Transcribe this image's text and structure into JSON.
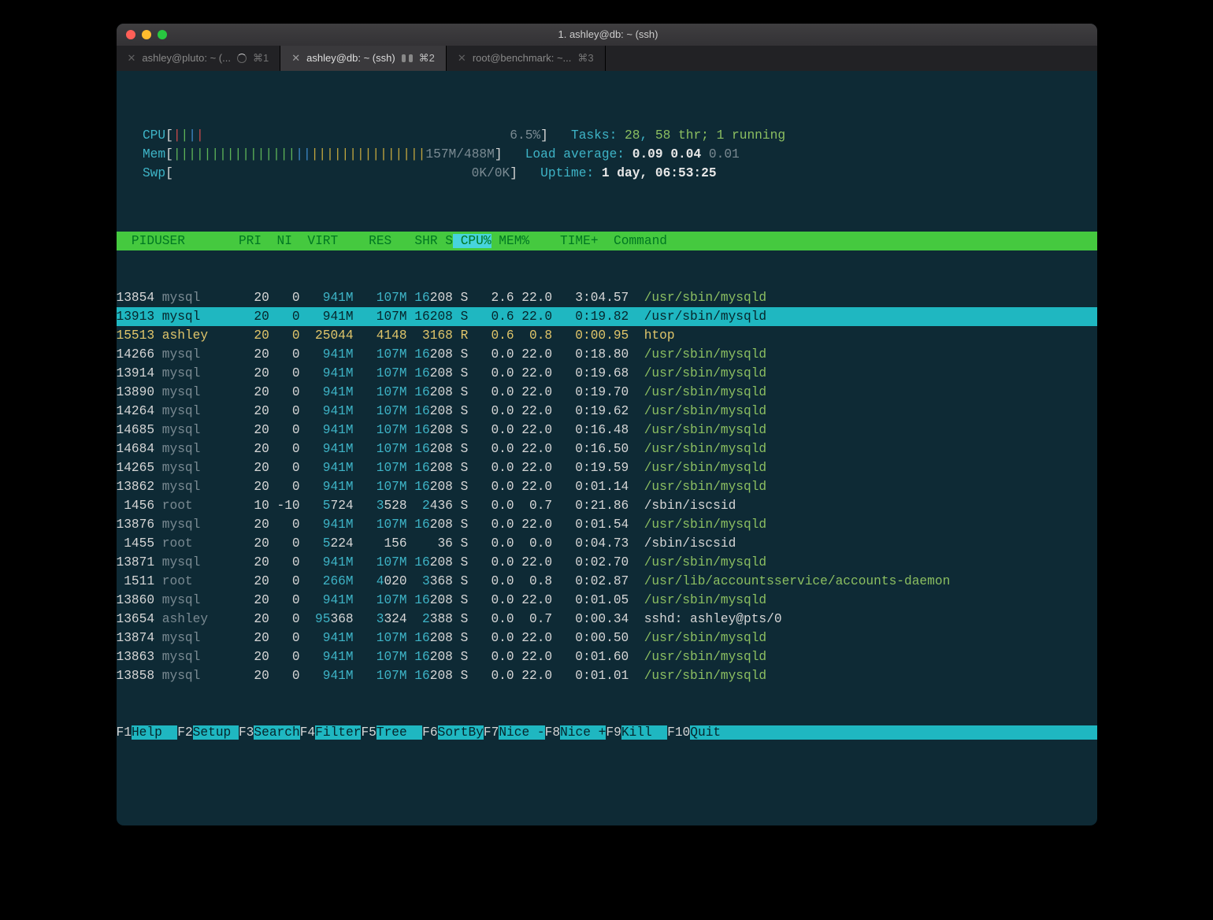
{
  "window": {
    "title": "1. ashley@db: ~ (ssh)"
  },
  "tabs": [
    {
      "label": "ashley@pluto: ~ (...",
      "shortcut": "⌘1",
      "active": false,
      "spinner": true
    },
    {
      "label": "ashley@db: ~ (ssh)",
      "shortcut": "⌘2",
      "active": true
    },
    {
      "label": "root@benchmark: ~...",
      "shortcut": "⌘3",
      "active": false
    }
  ],
  "meters": {
    "cpu": {
      "label": "CPU",
      "pct": "6.5%"
    },
    "mem": {
      "label": "Mem",
      "used": "157M",
      "total": "488M"
    },
    "swp": {
      "label": "Swp",
      "used": "0K",
      "total": "0K"
    },
    "tasks": {
      "label": "Tasks:",
      "procs": "28",
      "threads": "58 thr;",
      "running": "1 running"
    },
    "load": {
      "label": "Load average:",
      "l1": "0.09",
      "l2": "0.04",
      "l3": "0.01"
    },
    "uptime": {
      "label": "Uptime:",
      "val": "1 day, 06:53:25"
    }
  },
  "columns": [
    "  PID",
    "USER      ",
    " PRI",
    "  NI",
    "  VIRT",
    "    RES",
    "   SHR",
    " S",
    " CPU%",
    " MEM%",
    "    TIME+",
    "  Command"
  ],
  "processes": [
    {
      "pid": "13854",
      "user": "mysql",
      "pri": "20",
      "ni": "0",
      "virt": "941M",
      "res": "107M",
      "shr": "16208",
      "s": "S",
      "cpu": "2.6",
      "mem": "22.0",
      "time": "3:04.57",
      "cmd": "/usr/sbin/mysqld",
      "sel": false,
      "bold": false,
      "dimuser": true
    },
    {
      "pid": "13913",
      "user": "mysql",
      "pri": "20",
      "ni": "0",
      "virt": "941M",
      "res": "107M",
      "shr": "16208",
      "s": "S",
      "cpu": "0.6",
      "mem": "22.0",
      "time": "0:19.82",
      "cmd": "/usr/sbin/mysqld",
      "sel": true,
      "bold": false,
      "dimuser": false
    },
    {
      "pid": "15513",
      "user": "ashley",
      "pri": "20",
      "ni": "0",
      "virt": "25044",
      "res": "4148",
      "shr": "3168",
      "s": "R",
      "cpu": "0.6",
      "mem": "0.8",
      "time": "0:00.95",
      "cmd": "htop",
      "sel": false,
      "bold": true,
      "dimuser": false
    },
    {
      "pid": "14266",
      "user": "mysql",
      "pri": "20",
      "ni": "0",
      "virt": "941M",
      "res": "107M",
      "shr": "16208",
      "s": "S",
      "cpu": "0.0",
      "mem": "22.0",
      "time": "0:18.80",
      "cmd": "/usr/sbin/mysqld",
      "sel": false,
      "bold": false,
      "dimuser": true
    },
    {
      "pid": "13914",
      "user": "mysql",
      "pri": "20",
      "ni": "0",
      "virt": "941M",
      "res": "107M",
      "shr": "16208",
      "s": "S",
      "cpu": "0.0",
      "mem": "22.0",
      "time": "0:19.68",
      "cmd": "/usr/sbin/mysqld",
      "sel": false,
      "bold": false,
      "dimuser": true
    },
    {
      "pid": "13890",
      "user": "mysql",
      "pri": "20",
      "ni": "0",
      "virt": "941M",
      "res": "107M",
      "shr": "16208",
      "s": "S",
      "cpu": "0.0",
      "mem": "22.0",
      "time": "0:19.70",
      "cmd": "/usr/sbin/mysqld",
      "sel": false,
      "bold": false,
      "dimuser": true
    },
    {
      "pid": "14264",
      "user": "mysql",
      "pri": "20",
      "ni": "0",
      "virt": "941M",
      "res": "107M",
      "shr": "16208",
      "s": "S",
      "cpu": "0.0",
      "mem": "22.0",
      "time": "0:19.62",
      "cmd": "/usr/sbin/mysqld",
      "sel": false,
      "bold": false,
      "dimuser": true
    },
    {
      "pid": "14685",
      "user": "mysql",
      "pri": "20",
      "ni": "0",
      "virt": "941M",
      "res": "107M",
      "shr": "16208",
      "s": "S",
      "cpu": "0.0",
      "mem": "22.0",
      "time": "0:16.48",
      "cmd": "/usr/sbin/mysqld",
      "sel": false,
      "bold": false,
      "dimuser": true
    },
    {
      "pid": "14684",
      "user": "mysql",
      "pri": "20",
      "ni": "0",
      "virt": "941M",
      "res": "107M",
      "shr": "16208",
      "s": "S",
      "cpu": "0.0",
      "mem": "22.0",
      "time": "0:16.50",
      "cmd": "/usr/sbin/mysqld",
      "sel": false,
      "bold": false,
      "dimuser": true
    },
    {
      "pid": "14265",
      "user": "mysql",
      "pri": "20",
      "ni": "0",
      "virt": "941M",
      "res": "107M",
      "shr": "16208",
      "s": "S",
      "cpu": "0.0",
      "mem": "22.0",
      "time": "0:19.59",
      "cmd": "/usr/sbin/mysqld",
      "sel": false,
      "bold": false,
      "dimuser": true
    },
    {
      "pid": "13862",
      "user": "mysql",
      "pri": "20",
      "ni": "0",
      "virt": "941M",
      "res": "107M",
      "shr": "16208",
      "s": "S",
      "cpu": "0.0",
      "mem": "22.0",
      "time": "0:01.14",
      "cmd": "/usr/sbin/mysqld",
      "sel": false,
      "bold": false,
      "dimuser": true
    },
    {
      "pid": "1456",
      "user": "root",
      "pri": "10",
      "ni": "-10",
      "virt": "5724",
      "res": "3528",
      "shr": "2436",
      "s": "S",
      "cpu": "0.0",
      "mem": "0.7",
      "time": "0:21.86",
      "cmd": "/sbin/iscsid",
      "sel": false,
      "bold": false,
      "dimuser": true,
      "nineg": true,
      "cmdwhite": true
    },
    {
      "pid": "13876",
      "user": "mysql",
      "pri": "20",
      "ni": "0",
      "virt": "941M",
      "res": "107M",
      "shr": "16208",
      "s": "S",
      "cpu": "0.0",
      "mem": "22.0",
      "time": "0:01.54",
      "cmd": "/usr/sbin/mysqld",
      "sel": false,
      "bold": false,
      "dimuser": true
    },
    {
      "pid": "1455",
      "user": "root",
      "pri": "20",
      "ni": "0",
      "virt": "5224",
      "res": "156",
      "shr": "36",
      "s": "S",
      "cpu": "0.0",
      "mem": "0.0",
      "time": "0:04.73",
      "cmd": "/sbin/iscsid",
      "sel": false,
      "bold": false,
      "dimuser": true,
      "cmdwhite": true
    },
    {
      "pid": "13871",
      "user": "mysql",
      "pri": "20",
      "ni": "0",
      "virt": "941M",
      "res": "107M",
      "shr": "16208",
      "s": "S",
      "cpu": "0.0",
      "mem": "22.0",
      "time": "0:02.70",
      "cmd": "/usr/sbin/mysqld",
      "sel": false,
      "bold": false,
      "dimuser": true
    },
    {
      "pid": "1511",
      "user": "root",
      "pri": "20",
      "ni": "0",
      "virt": "266M",
      "res": "4020",
      "shr": "3368",
      "s": "S",
      "cpu": "0.0",
      "mem": "0.8",
      "time": "0:02.87",
      "cmd": "/usr/lib/accountsservice/accounts-daemon",
      "sel": false,
      "bold": false,
      "dimuser": true
    },
    {
      "pid": "13860",
      "user": "mysql",
      "pri": "20",
      "ni": "0",
      "virt": "941M",
      "res": "107M",
      "shr": "16208",
      "s": "S",
      "cpu": "0.0",
      "mem": "22.0",
      "time": "0:01.05",
      "cmd": "/usr/sbin/mysqld",
      "sel": false,
      "bold": false,
      "dimuser": true
    },
    {
      "pid": "13654",
      "user": "ashley",
      "pri": "20",
      "ni": "0",
      "virt": "95368",
      "res": "3324",
      "shr": "2388",
      "s": "S",
      "cpu": "0.0",
      "mem": "0.7",
      "time": "0:00.34",
      "cmd": "sshd: ashley@pts/0",
      "sel": false,
      "bold": false,
      "dimuser": false,
      "cmdwhite": true
    },
    {
      "pid": "13874",
      "user": "mysql",
      "pri": "20",
      "ni": "0",
      "virt": "941M",
      "res": "107M",
      "shr": "16208",
      "s": "S",
      "cpu": "0.0",
      "mem": "22.0",
      "time": "0:00.50",
      "cmd": "/usr/sbin/mysqld",
      "sel": false,
      "bold": false,
      "dimuser": true
    },
    {
      "pid": "13863",
      "user": "mysql",
      "pri": "20",
      "ni": "0",
      "virt": "941M",
      "res": "107M",
      "shr": "16208",
      "s": "S",
      "cpu": "0.0",
      "mem": "22.0",
      "time": "0:01.60",
      "cmd": "/usr/sbin/mysqld",
      "sel": false,
      "bold": false,
      "dimuser": true
    },
    {
      "pid": "13858",
      "user": "mysql",
      "pri": "20",
      "ni": "0",
      "virt": "941M",
      "res": "107M",
      "shr": "16208",
      "s": "S",
      "cpu": "0.0",
      "mem": "22.0",
      "time": "0:01.01",
      "cmd": "/usr/sbin/mysqld",
      "sel": false,
      "bold": false,
      "dimuser": true
    }
  ],
  "fkeys": [
    {
      "k": "F1",
      "l": "Help  "
    },
    {
      "k": "F2",
      "l": "Setup "
    },
    {
      "k": "F3",
      "l": "Search"
    },
    {
      "k": "F4",
      "l": "Filter"
    },
    {
      "k": "F5",
      "l": "Tree  "
    },
    {
      "k": "F6",
      "l": "SortBy"
    },
    {
      "k": "F7",
      "l": "Nice -"
    },
    {
      "k": "F8",
      "l": "Nice +"
    },
    {
      "k": "F9",
      "l": "Kill  "
    },
    {
      "k": "F10",
      "l": "Quit"
    }
  ]
}
